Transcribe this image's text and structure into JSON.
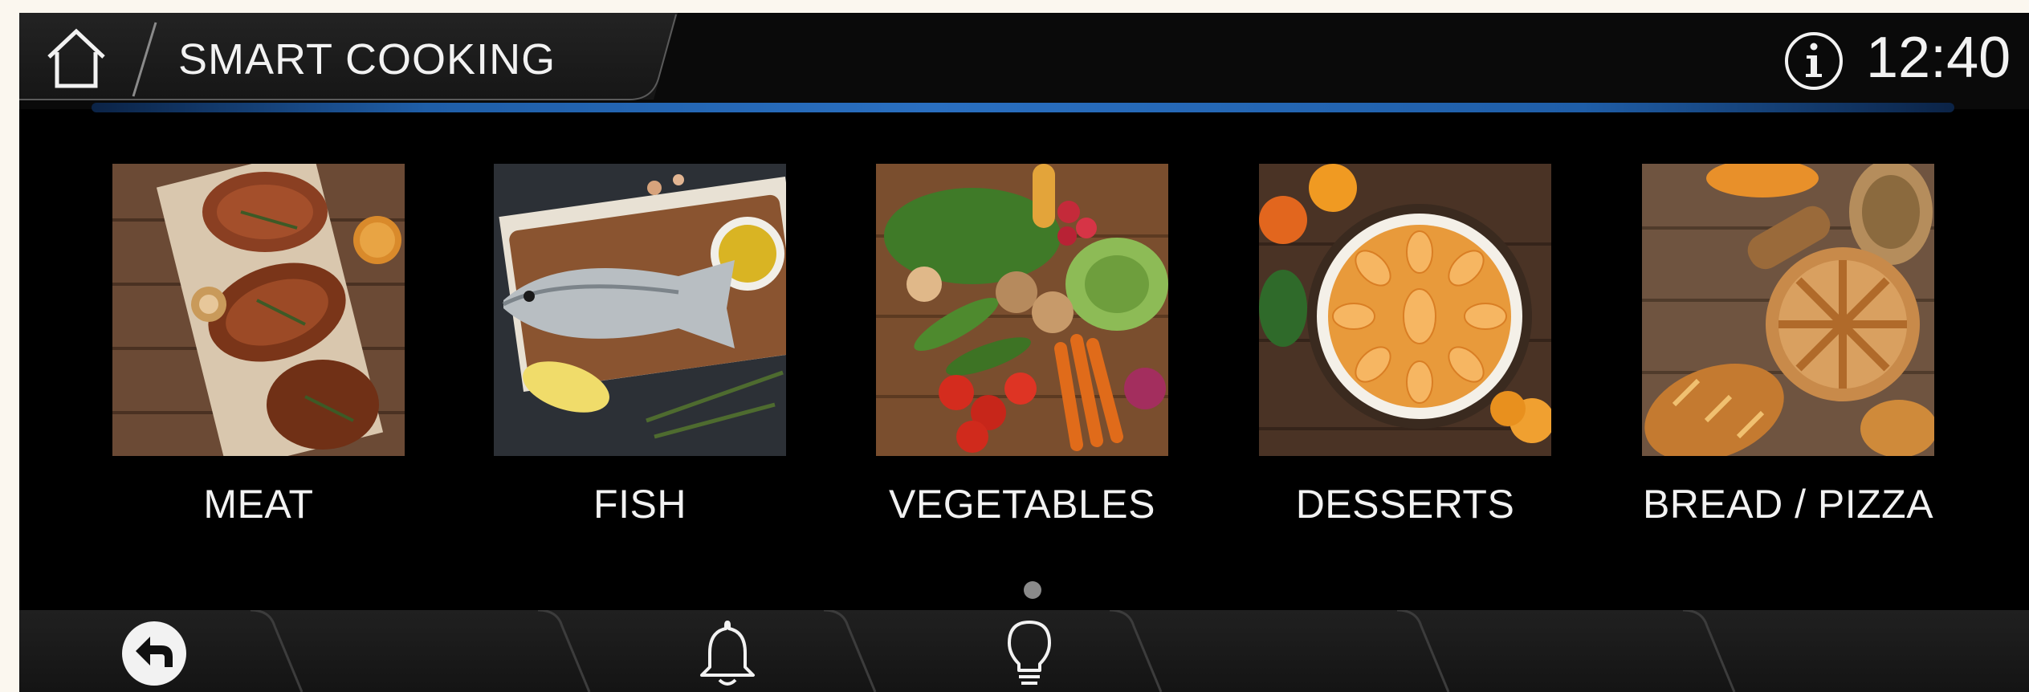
{
  "header": {
    "title": "SMART COOKING",
    "time": "12:40",
    "home_icon": "home-icon",
    "info_icon": "info-icon"
  },
  "categories": [
    {
      "label": "MEAT",
      "image": "meat-photo"
    },
    {
      "label": "FISH",
      "image": "fish-photo"
    },
    {
      "label": "VEGETABLES",
      "image": "vegetables-photo"
    },
    {
      "label": "DESSERTS",
      "image": "desserts-photo"
    },
    {
      "label": "BREAD / PIZZA",
      "image": "bread-pizza-photo"
    }
  ],
  "pagination": {
    "current_page": 1,
    "total_pages": 1
  },
  "bottom_bar": {
    "items": [
      {
        "icon": "back-arrow-icon"
      },
      {
        "icon": "bell-icon"
      },
      {
        "icon": "lightbulb-icon"
      }
    ]
  },
  "colors": {
    "background": "#000000",
    "accent": "#2a6fc0",
    "text": "#f2f2f2",
    "outer_frame": "#fbf7ef"
  }
}
